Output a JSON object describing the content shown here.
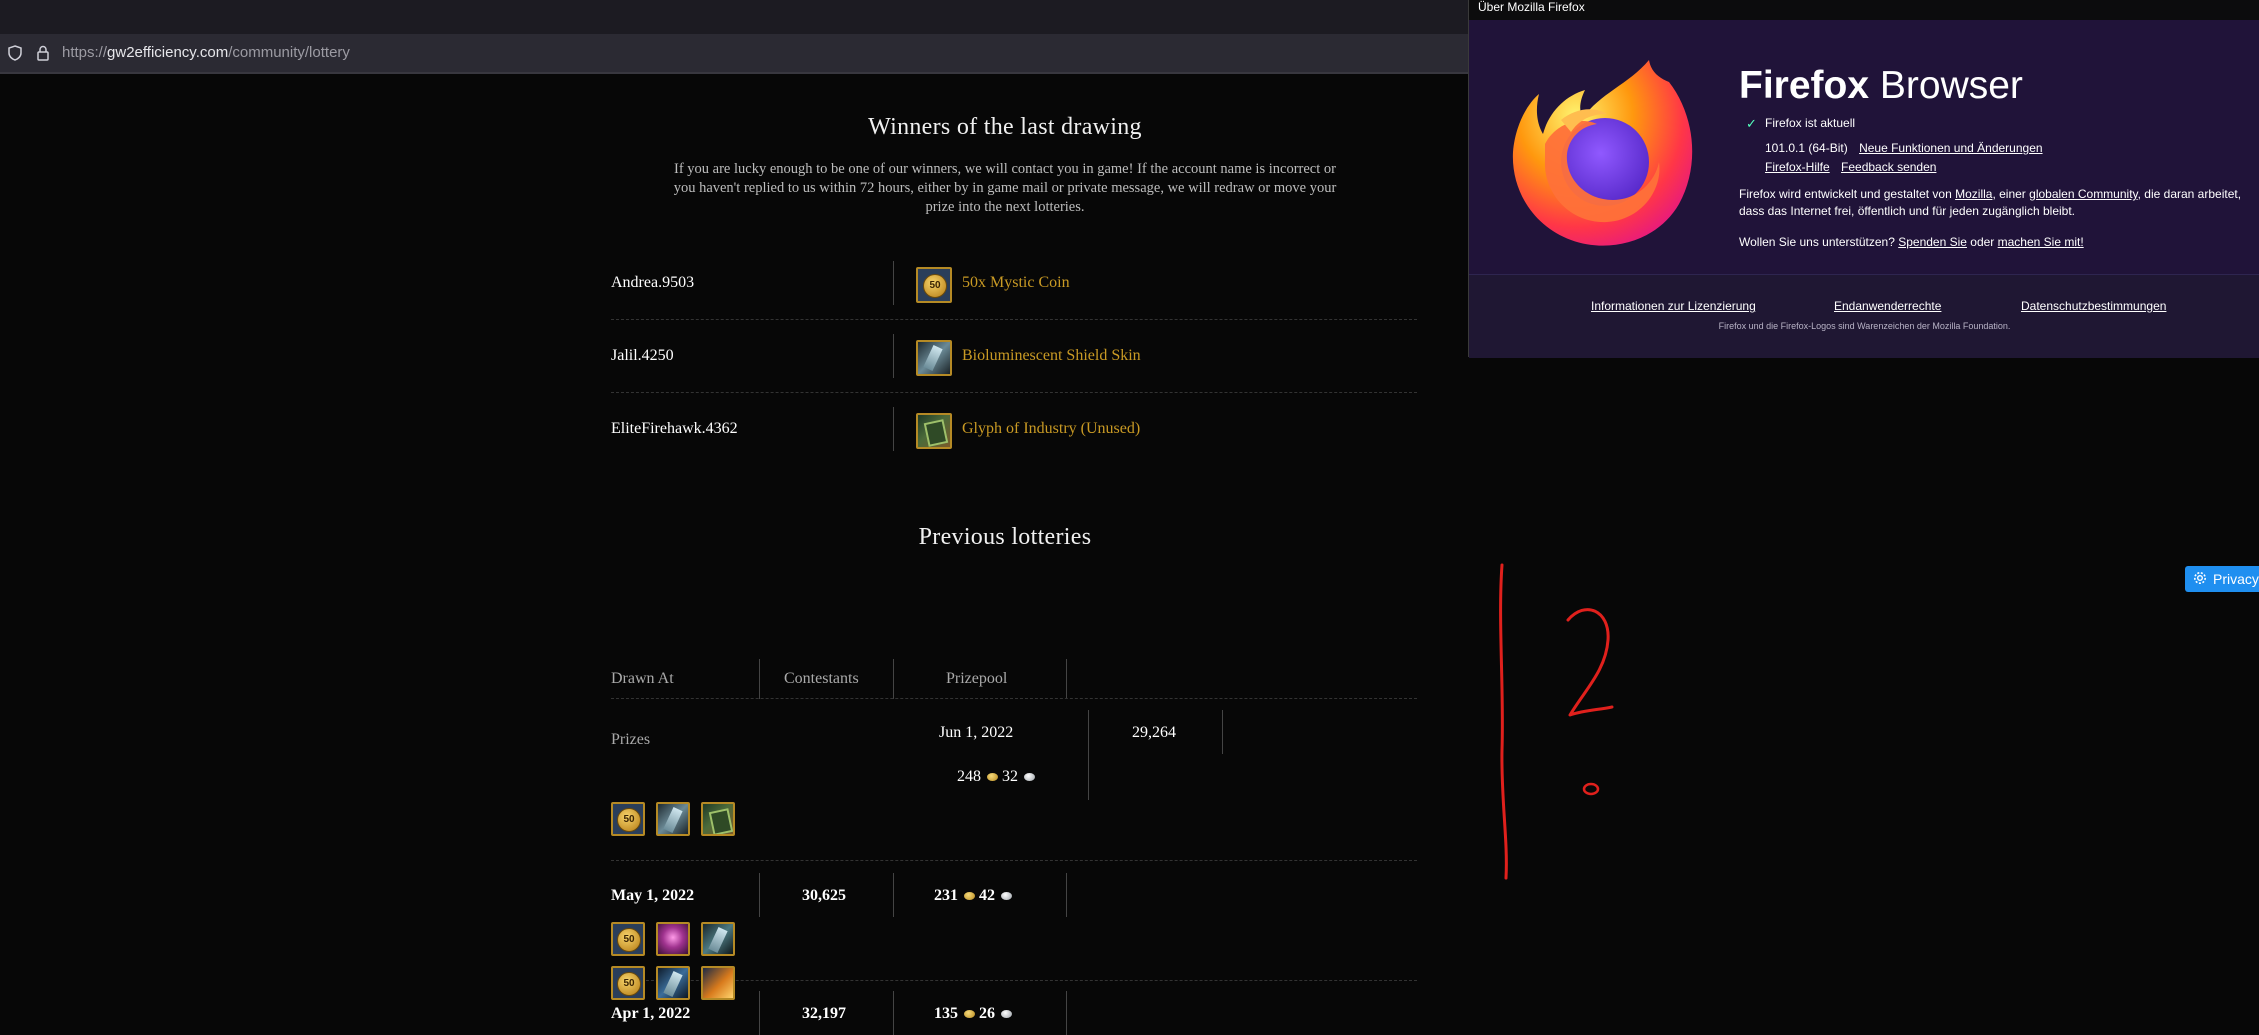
{
  "browser": {
    "url_prefix": "https://",
    "url_host": "gw2efficiency.com",
    "url_path": "/community/lottery"
  },
  "winners": {
    "title": "Winners of the last drawing",
    "intro": "If you are lucky enough to be one of our winners, we will contact you in game! If the account name is incorrect or you haven't replied to us within 72 hours, either by in game mail or private message, we will redraw or move your prize into the next lotteries.",
    "rows": [
      {
        "name": "Andrea.9503",
        "prize": "50x Mystic Coin",
        "icon": "mystic-coin-icon"
      },
      {
        "name": "Jalil.4250",
        "prize": "Bioluminescent Shield Skin",
        "icon": "shield-skin-icon"
      },
      {
        "name": "EliteFirehawk.4362",
        "prize": "Glyph of Industry (Unused)",
        "icon": "glyph-icon"
      }
    ]
  },
  "previous": {
    "title": "Previous lotteries",
    "headers": {
      "drawn_at": "Drawn At",
      "contestants": "Contestants",
      "prizepool": "Prizepool",
      "prizes": "Prizes"
    },
    "rows": [
      {
        "date": "Jun 1, 2022",
        "contestants": "29,264",
        "gold": "248",
        "silver": "32"
      },
      {
        "date": "May 1, 2022",
        "contestants": "30,625",
        "gold": "231",
        "silver": "42"
      },
      {
        "date": "Apr 1, 2022",
        "contestants": "32,197",
        "gold": "135",
        "silver": "26"
      }
    ],
    "coin_label": "50"
  },
  "privacy_button": {
    "label": "Privacy"
  },
  "about_dialog": {
    "window_title": "Über Mozilla Firefox",
    "brand_bold": "Firefox",
    "brand_light": "Browser",
    "status": "Firefox ist aktuell",
    "version": "101.0.1 (64-Bit)",
    "link_changes": "Neue Funktionen und Änderungen",
    "link_help": "Firefox-Hilfe",
    "link_feedback": "Feedback senden",
    "desc_1": "Firefox wird entwickelt und gestaltet von ",
    "desc_mozilla": "Mozilla",
    "desc_2": ", einer ",
    "desc_community": "globalen Community",
    "desc_3": ", die daran arbeitet, dass das Internet frei, öffentlich und für jeden zugänglich bleibt.",
    "support_1": "Wollen Sie uns unterstützen? ",
    "support_donate": "Spenden Sie",
    "support_2": " oder ",
    "support_join": "machen Sie mit!",
    "footer_license": "Informationen zur Lizenzierung",
    "footer_rights": "Endanwenderrechte",
    "footer_privacy": "Datenschutzbestimmungen",
    "trademark": "Firefox und die Firefox-Logos sind Warenzeichen der Mozilla Foundation."
  },
  "annotation": {
    "color": "#e0201c"
  }
}
